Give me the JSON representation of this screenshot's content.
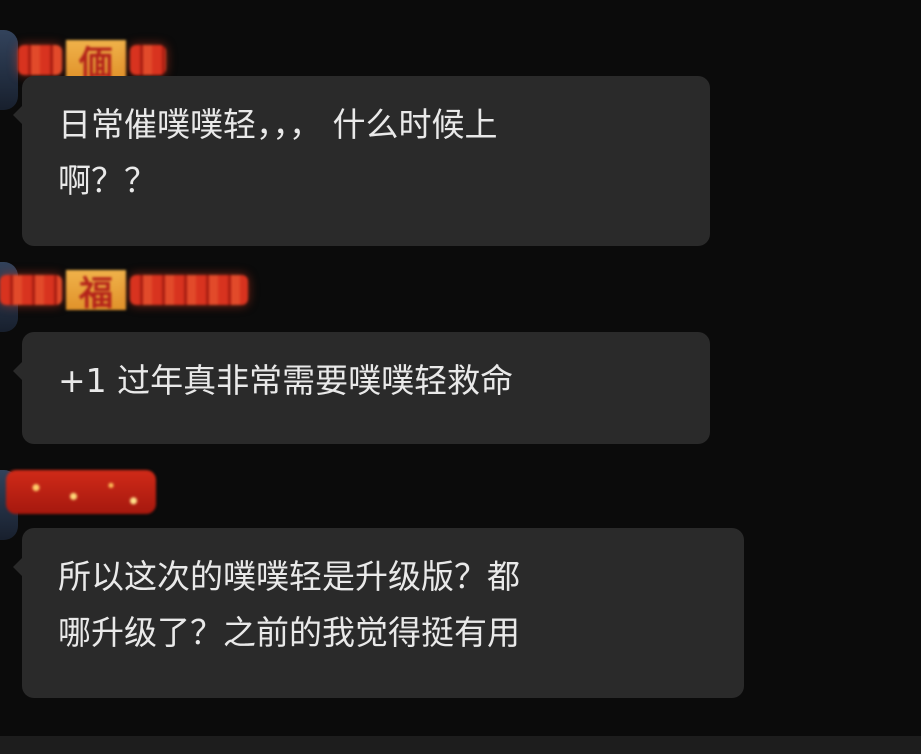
{
  "messages": [
    {
      "sender_tag_char": "偭",
      "lines": [
        "日常催噗噗轻，，，  什么时候上",
        "啊？？"
      ]
    },
    {
      "sender_tag_char": "福",
      "lines": [
        "+1 过年真非常需要噗噗轻救命"
      ]
    },
    {
      "sender_tag_char": "",
      "lines": [
        "所以这次的噗噗轻是升级版？都",
        "哪升级了？之前的我觉得挺有用"
      ]
    }
  ],
  "colors": {
    "background": "#0b0b0b",
    "bubble": "#2a2a2a",
    "text": "#e9e9e9",
    "tag_red": "#d8331f",
    "tag_gold": "#f0b24a"
  }
}
